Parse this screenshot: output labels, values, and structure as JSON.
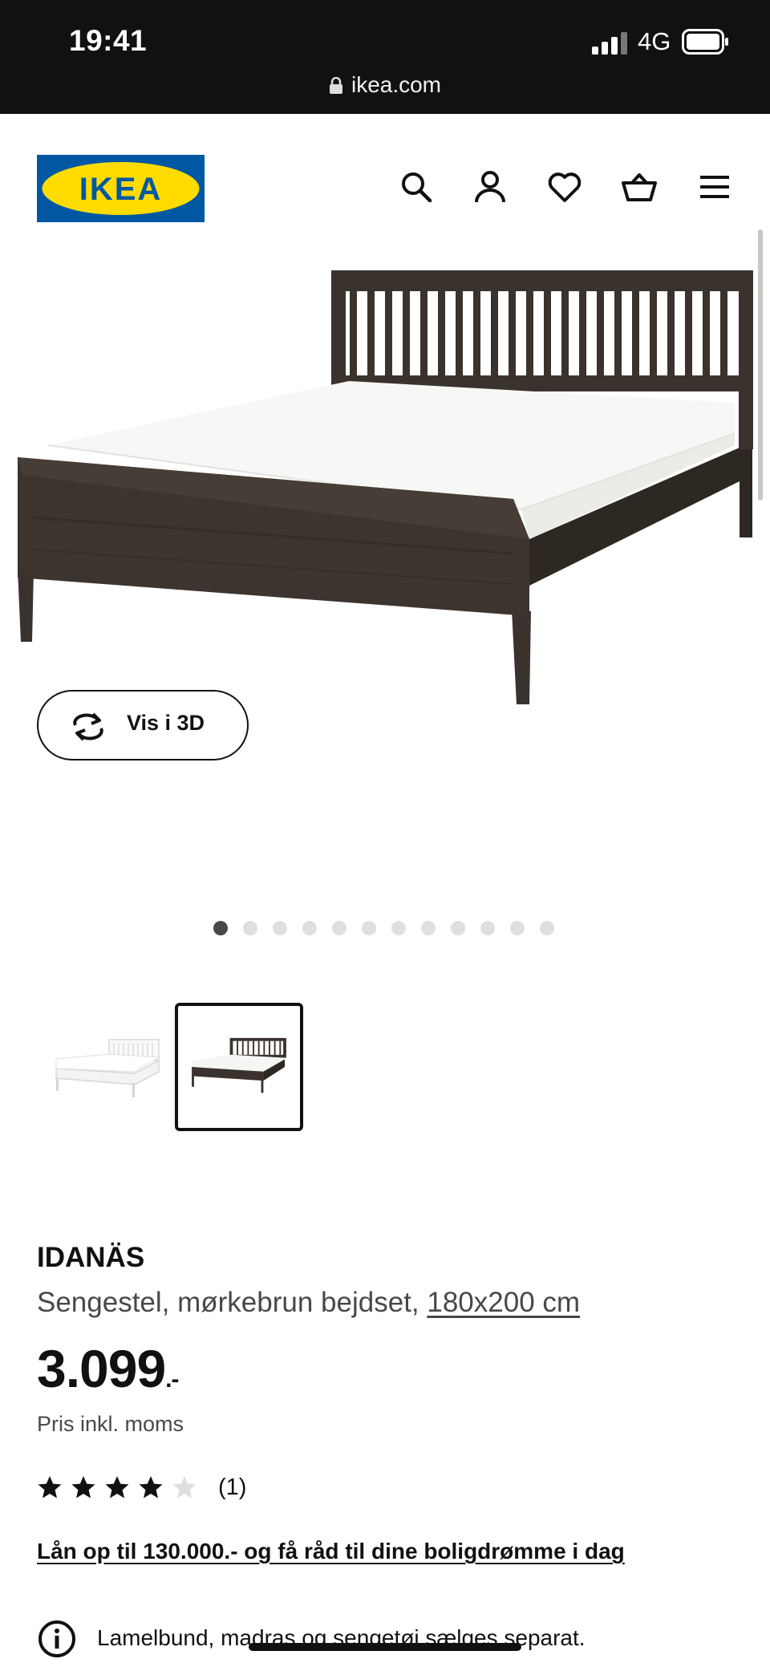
{
  "status_bar": {
    "time": "19:41",
    "network": "4G",
    "url": "ikea.com"
  },
  "header": {
    "logo_text": "IKEA",
    "logo_colors": {
      "blue": "#0058A3",
      "yellow": "#FFDB00"
    },
    "icons": [
      "search-icon",
      "account-icon",
      "heart-icon",
      "basket-icon",
      "menu-icon"
    ]
  },
  "hero": {
    "view_3d_label": "Vis i 3D",
    "image_count": 12,
    "active_image": 1
  },
  "thumbnails": [
    {
      "name": "bed-white-variant",
      "selected": false
    },
    {
      "name": "bed-dark-brown-variant",
      "selected": true
    }
  ],
  "product": {
    "name": "IDANÄS",
    "description": "Sengestel, mørkebrun bejdset,",
    "size_link": "180x200 cm",
    "price": "3.099",
    "price_suffix": ".-",
    "vat_note": "Pris inkl. moms",
    "rating_value": 4,
    "rating_max": 5,
    "review_count": "(1)",
    "loan_link": "Lån op til 130.000.- og få råd til dine boligdrømme i dag",
    "notice": "Lamelbund, madras og sengetøj sælges separat."
  },
  "colors": {
    "text": "#111111",
    "muted": "#484848",
    "bed_dark": "#3a332d",
    "mattress": "#f7f7f5"
  }
}
